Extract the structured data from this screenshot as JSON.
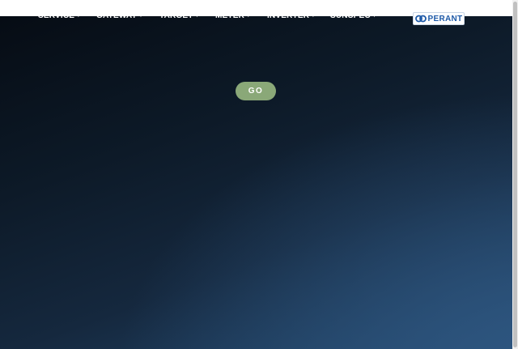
{
  "nav": {
    "items": [
      {
        "label": "SERVICE"
      },
      {
        "label": "GATEWAY"
      },
      {
        "label": "TARGET"
      },
      {
        "label": "METER"
      },
      {
        "label": "INVERTER"
      },
      {
        "label": "SUNSPEC"
      }
    ]
  },
  "logo": {
    "text": "PERANT"
  },
  "hero": {
    "go_label": "GO"
  },
  "colors": {
    "go_button": "#8aa878",
    "hero_dark": "#060c14",
    "hero_light": "#2e5680",
    "logo_text": "#1e5aa8"
  }
}
